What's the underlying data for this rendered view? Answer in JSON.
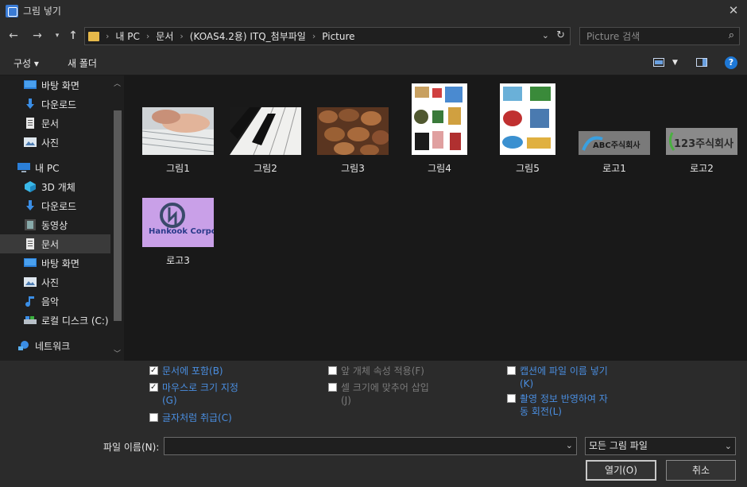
{
  "window": {
    "title": "그림 넣기"
  },
  "address": {
    "crumbs": [
      "내 PC",
      "문서",
      "(KOAS4.2용) ITQ_첨부파일",
      "Picture"
    ]
  },
  "search": {
    "placeholder": "Picture 검색"
  },
  "toolbar": {
    "organize_label": "구성 ▾",
    "new_folder_label": "새 폴더",
    "help_label": "?"
  },
  "sidebar": {
    "items": [
      {
        "label": "바탕 화면",
        "icon": "desktop-icon",
        "pinned": true
      },
      {
        "label": "다운로드",
        "icon": "download-icon",
        "pinned": true
      },
      {
        "label": "문서",
        "icon": "document-icon",
        "pinned": true
      },
      {
        "label": "사진",
        "icon": "pictures-icon",
        "pinned": true
      },
      {
        "label": "내 PC",
        "icon": "pc-icon"
      },
      {
        "label": "3D 개체",
        "icon": "3d-objects-icon"
      },
      {
        "label": "다운로드",
        "icon": "download-icon"
      },
      {
        "label": "동영상",
        "icon": "video-icon"
      },
      {
        "label": "문서",
        "icon": "document-icon",
        "selected": true
      },
      {
        "label": "바탕 화면",
        "icon": "desktop-icon"
      },
      {
        "label": "사진",
        "icon": "pictures-icon"
      },
      {
        "label": "음악",
        "icon": "music-icon"
      },
      {
        "label": "로컬 디스크 (C:)",
        "icon": "disk-icon"
      },
      {
        "label": "네트워크",
        "icon": "network-icon"
      }
    ]
  },
  "files": [
    {
      "name": "그림1"
    },
    {
      "name": "그림2"
    },
    {
      "name": "그림3"
    },
    {
      "name": "그림4"
    },
    {
      "name": "그림5"
    },
    {
      "name": "로고1",
      "logo_text": "ABC주식회사"
    },
    {
      "name": "로고2",
      "logo_text": "123주식회사"
    },
    {
      "name": "로고3",
      "logo_text": "Hankook Corporation"
    }
  ],
  "options": {
    "include_in_doc": {
      "label": "문서에 포함(B)",
      "checked": true
    },
    "mouse_size": {
      "label": "마우스로 크기 지정(G)",
      "checked": true
    },
    "treat_as_char": {
      "label": "글자처럼 취급(C)",
      "checked": false
    },
    "apply_front_object": {
      "label": "앞 개체 속성 적용(F)",
      "checked": false
    },
    "fit_cell": {
      "label": "셀 크기에 맞추어 삽입(J)",
      "checked": false
    },
    "caption_filename": {
      "label": "캡션에 파일 이름 넣기(K)",
      "checked": false
    },
    "auto_rotate": {
      "label": "촬영 정보 반영하여 자동 회전(L)",
      "checked": false
    }
  },
  "footer": {
    "filename_label": "파일 이름(N):",
    "filename_value": "",
    "filetype_value": "모든 그림 파일",
    "open_label": "열기(O)",
    "cancel_label": "취소"
  },
  "colors": {
    "accent": "#1e78d6",
    "link_label": "#4a8ee0",
    "folder": "#e6b94a"
  }
}
